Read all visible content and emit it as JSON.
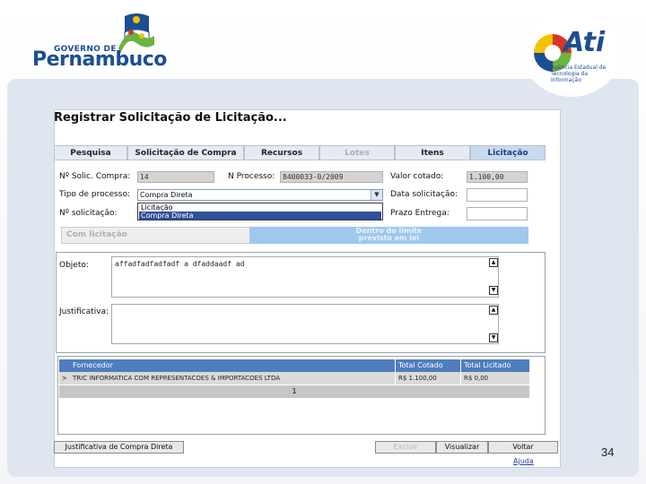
{
  "branding": {
    "gov_line1": "GOVERNO DE",
    "gov_line2": "Pernambuco",
    "ati_name": "Ati",
    "ati_subtitle": "Agência Estadual de Tecnologia da Informação",
    "colors": {
      "primary": "#1c4e94",
      "green": "#6cb33f",
      "yellow": "#f2c300",
      "red": "#d6372b"
    }
  },
  "window": {
    "title": "Registrar Solicitação de Licitação...",
    "tabs": [
      {
        "label": "Pesquisa",
        "state": "normal"
      },
      {
        "label": "Solicitação de Compra",
        "state": "normal"
      },
      {
        "label": "Recursos",
        "state": "normal"
      },
      {
        "label": "Lotes",
        "state": "disabled"
      },
      {
        "label": "Itens",
        "state": "normal"
      },
      {
        "label": "Licitação",
        "state": "active"
      }
    ]
  },
  "form": {
    "sol_compra_label": "Nº Solic. Compra:",
    "sol_compra_value": "14",
    "processo_label": "N Processo:",
    "processo_value": "8400033-0/2009",
    "valor_cotado_label": "Valor cotado:",
    "valor_cotado_value": "1.100,00",
    "tipo_processo_label": "Tipo de processo:",
    "tipo_processo_value": "Compra Direta",
    "tipo_processo_options": [
      "Licitação",
      "Compra Direta"
    ],
    "data_solicitacao_label": "Data solicitação:",
    "solicitacao_label": "Nº solicitação:",
    "prazo_entrega_label": "Prazo Entrega:",
    "status_left": "Com licitação",
    "status_right_line1": "Dentro do limite",
    "status_right_line2": "previsto em lei",
    "objeto_label": "Objeto:",
    "objeto_value": "affadfadfadfadf a dfaddaadf ad",
    "justificativa_label": "Justificativa:",
    "justificativa_value": ""
  },
  "grid": {
    "columns": [
      "Fornecedor",
      "Total Cotado",
      "Total Licitado"
    ],
    "rows": [
      {
        "marker": ">",
        "fornecedor": "TRIC INFORMATICA COM REPRESENTACOES & IMPORTACOES LTDA",
        "total_cotado": "R$ 1.100,00",
        "total_licitado": "R$ 0,00"
      }
    ],
    "page": "1"
  },
  "buttons": {
    "justificativa": "Justificativa de Compra Direta",
    "excluir": "Excluir",
    "visualizar": "Visualizar",
    "voltar": "Voltar",
    "ajuda": "Ajuda"
  },
  "slide": {
    "page_number": "34"
  }
}
